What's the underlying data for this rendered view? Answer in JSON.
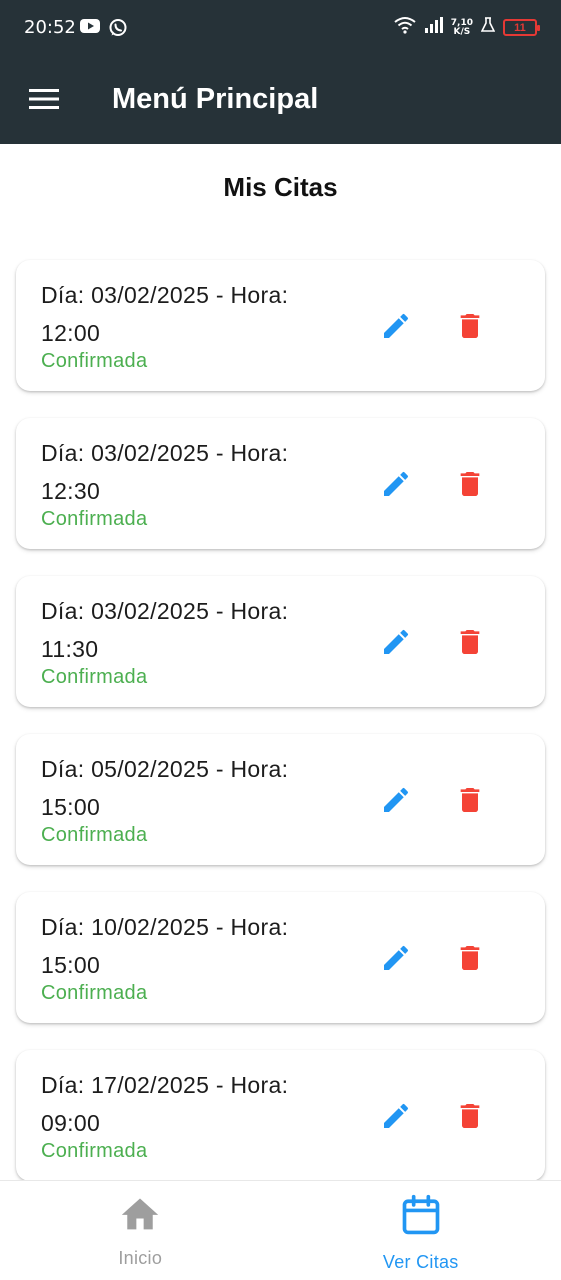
{
  "status_bar": {
    "time": "20:52",
    "net_speed_value": "7,10",
    "net_speed_unit": "K/S",
    "battery": "11",
    "icons": [
      "youtube-icon",
      "whatsapp-icon",
      "wifi-icon",
      "signal-icon",
      "flask-icon",
      "battery-icon"
    ]
  },
  "app_bar": {
    "title": "Menú Principal",
    "menu_icon": "menu-icon"
  },
  "page": {
    "title": "Mis Citas"
  },
  "appointments": [
    {
      "line1": "Día: 03/02/2025 - Hora:",
      "line2": "12:00",
      "status": "Confirmada"
    },
    {
      "line1": "Día: 03/02/2025 - Hora:",
      "line2": "12:30",
      "status": "Confirmada"
    },
    {
      "line1": "Día: 03/02/2025 - Hora:",
      "line2": "11:30",
      "status": "Confirmada"
    },
    {
      "line1": "Día: 05/02/2025 - Hora:",
      "line2": "15:00",
      "status": "Confirmada"
    },
    {
      "line1": "Día: 10/02/2025 - Hora:",
      "line2": "15:00",
      "status": "Confirmada"
    },
    {
      "line1": "Día: 17/02/2025 - Hora:",
      "line2": "09:00",
      "status": "Confirmada"
    }
  ],
  "bottom_nav": {
    "items": [
      {
        "label": "Inicio",
        "icon": "home-icon",
        "active": false
      },
      {
        "label": "Ver Citas",
        "icon": "calendar-icon",
        "active": true
      }
    ]
  },
  "colors": {
    "app_bar": "#263238",
    "status_confirmed": "#4caf50",
    "edit": "#2196f3",
    "delete": "#f44336",
    "nav_active": "#2196f3",
    "nav_inactive": "#9e9e9e"
  }
}
